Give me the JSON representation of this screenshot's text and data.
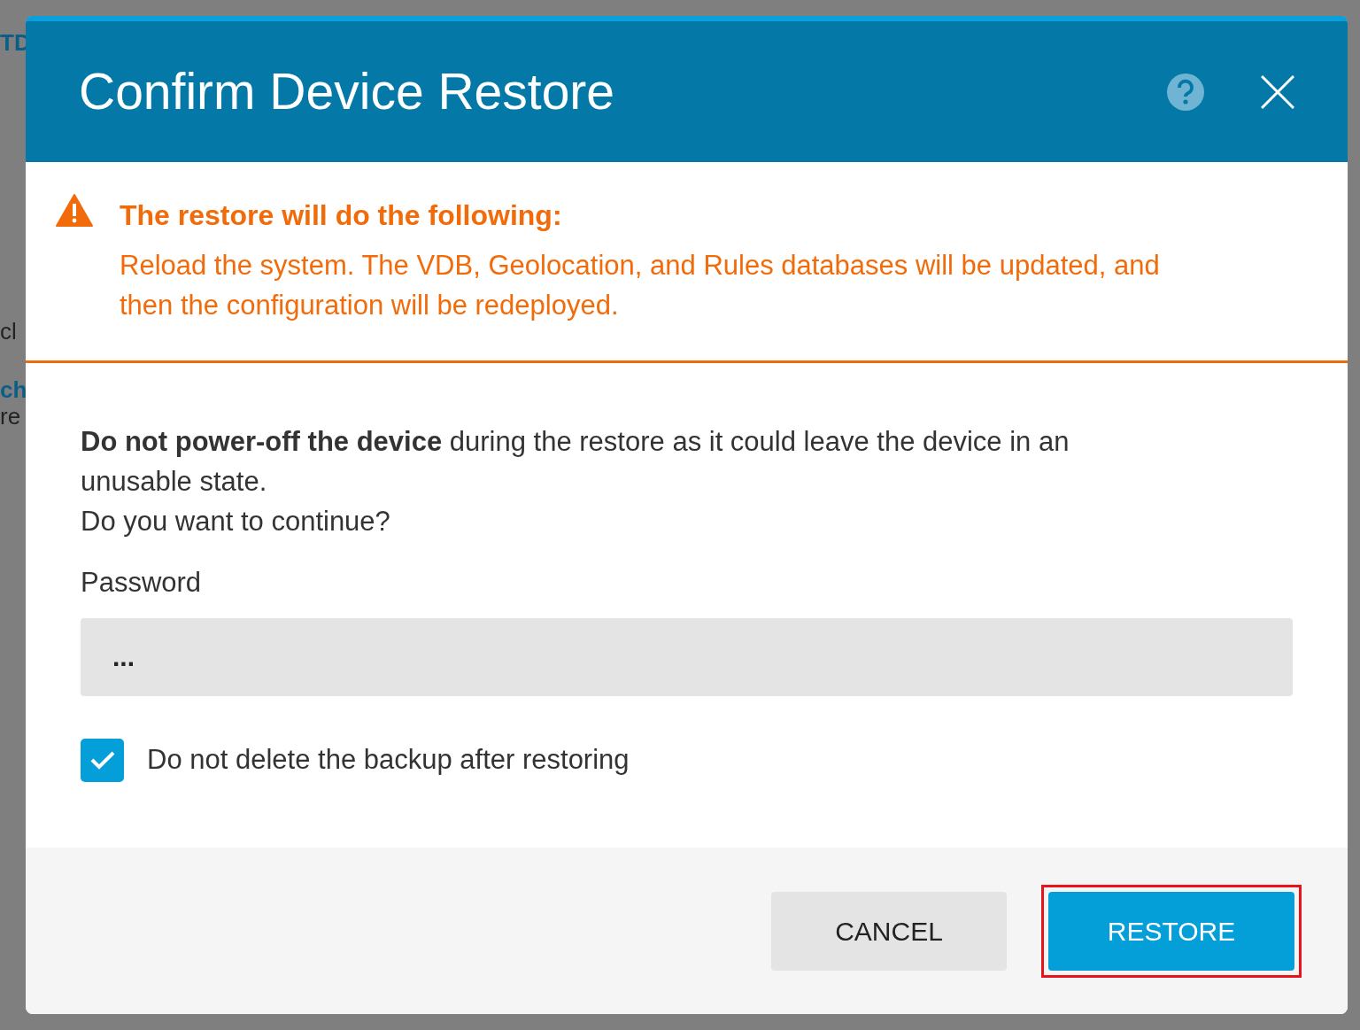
{
  "background": {
    "fragments": [
      "TD",
      "cl",
      "ch",
      "re"
    ]
  },
  "dialog": {
    "title": "Confirm Device Restore",
    "warning": {
      "heading": "The restore will do the following:",
      "text": "Reload the system. The VDB, Geolocation, and Rules databases will be updated, and then the configuration will be redeployed."
    },
    "message": "**Do not power-off the device** during the restore as it could leave the device in an unusable state.",
    "question": "Do you want to continue?",
    "password": {
      "label": "Password",
      "value": "..."
    },
    "checkbox": {
      "label": "Do not delete the backup after restoring",
      "checked": true
    },
    "buttons": [
      {
        "label": "CANCEL",
        "kind": "secondary",
        "highlighted": false
      },
      {
        "label": "RESTORE",
        "kind": "primary",
        "highlighted": true
      }
    ]
  }
}
